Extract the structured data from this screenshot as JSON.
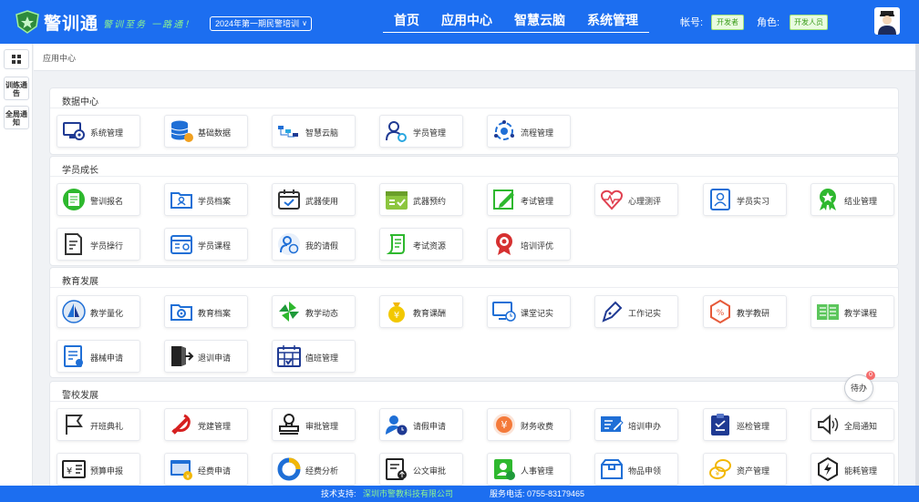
{
  "header": {
    "logo_text": "警训通",
    "slogan": "警训至务 一路通！",
    "period": "2024年第一期民警培训",
    "nav": [
      "首页",
      "应用中心",
      "智慧云脑",
      "系统管理"
    ],
    "account_label": "帐号:",
    "account_value": "开发者",
    "role_label": "角色:",
    "role_value": "开发人员"
  },
  "sidebar": {
    "items": [
      "训练通告",
      "全局通知"
    ]
  },
  "breadcrumb": "应用中心",
  "sections": [
    {
      "title": "数据中心",
      "items": [
        {
          "label": "系统管理",
          "icon": "monitor-gear-icon"
        },
        {
          "label": "基础数据",
          "icon": "database-icon"
        },
        {
          "label": "智慧云脑",
          "icon": "flow-chart-icon"
        },
        {
          "label": "学员管理",
          "icon": "user-gear-icon"
        },
        {
          "label": "流程管理",
          "icon": "process-gear-icon"
        }
      ]
    },
    {
      "title": "学员成长",
      "items": [
        {
          "label": "警训报名",
          "icon": "signup-form-icon"
        },
        {
          "label": "学员档案",
          "icon": "folder-user-icon"
        },
        {
          "label": "武器使用",
          "icon": "calendar-check-icon"
        },
        {
          "label": "武器预约",
          "icon": "calendar-list-icon"
        },
        {
          "label": "考试管理",
          "icon": "edit-icon"
        },
        {
          "label": "心理测评",
          "icon": "heart-pulse-icon"
        },
        {
          "label": "学员实习",
          "icon": "id-card-icon"
        },
        {
          "label": "结业管理",
          "icon": "award-icon"
        },
        {
          "label": "学员操行",
          "icon": "document-edit-icon"
        },
        {
          "label": "学员课程",
          "icon": "calendar-user-icon"
        },
        {
          "label": "我的请假",
          "icon": "user-clock-icon"
        },
        {
          "label": "考试资源",
          "icon": "scroll-icon"
        },
        {
          "label": "培训评优",
          "icon": "medal-icon"
        }
      ]
    },
    {
      "title": "教育发展",
      "items": [
        {
          "label": "教学量化",
          "icon": "sailboat-icon"
        },
        {
          "label": "教育档案",
          "icon": "folder-gear-icon"
        },
        {
          "label": "教学动态",
          "icon": "pinwheel-icon"
        },
        {
          "label": "教育课酬",
          "icon": "money-bag-icon"
        },
        {
          "label": "课堂记实",
          "icon": "monitor-clock-icon"
        },
        {
          "label": "工作记实",
          "icon": "pen-nib-icon"
        },
        {
          "label": "教学教研",
          "icon": "hexagon-percent-icon"
        },
        {
          "label": "教学课程",
          "icon": "grid-book-icon"
        },
        {
          "label": "器械申请",
          "icon": "form-check-icon"
        },
        {
          "label": "退训申请",
          "icon": "exit-door-icon"
        },
        {
          "label": "值班管理",
          "icon": "calendar-duty-icon"
        }
      ]
    },
    {
      "title": "警校发展",
      "items": [
        {
          "label": "开班典礼",
          "icon": "flag-icon"
        },
        {
          "label": "党建管理",
          "icon": "party-emblem-icon"
        },
        {
          "label": "审批管理",
          "icon": "stamp-icon"
        },
        {
          "label": "请假申请",
          "icon": "user-clock-blue-icon"
        },
        {
          "label": "财务收费",
          "icon": "yen-coin-icon"
        },
        {
          "label": "培训申办",
          "icon": "form-edit-icon"
        },
        {
          "label": "巡检管理",
          "icon": "clipboard-icon"
        },
        {
          "label": "全局通知",
          "icon": "speaker-icon"
        },
        {
          "label": "预算申报",
          "icon": "yen-board-icon"
        },
        {
          "label": "经费申请",
          "icon": "browser-coin-icon"
        },
        {
          "label": "经费分析",
          "icon": "donut-chart-icon"
        },
        {
          "label": "公文审批",
          "icon": "doc-upload-icon"
        },
        {
          "label": "人事管理",
          "icon": "id-badge-icon"
        },
        {
          "label": "物品申领",
          "icon": "box-icon"
        },
        {
          "label": "资产管理",
          "icon": "coins-icon"
        },
        {
          "label": "能耗管理",
          "icon": "energy-icon"
        }
      ]
    }
  ],
  "todo": {
    "label": "待办",
    "count": "0"
  },
  "footer": {
    "support_label": "技术支持:",
    "support_value": "深圳市警教科技有限公司",
    "phone": "服务电话: 0755-83179465"
  }
}
